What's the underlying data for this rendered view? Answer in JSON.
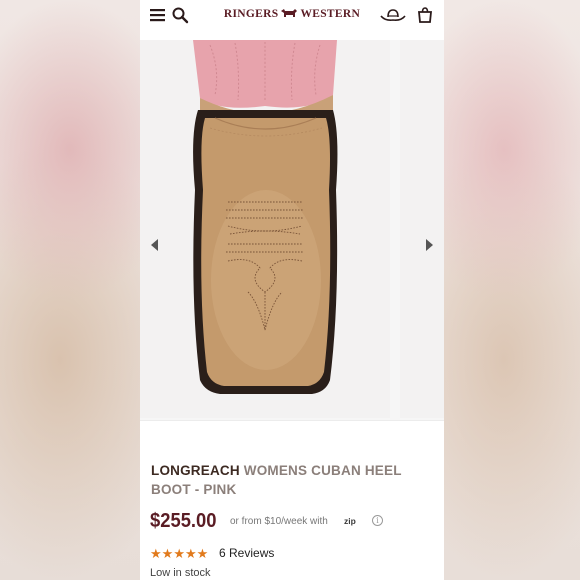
{
  "header": {
    "brand_left": "RINGERS",
    "brand_right": "WESTERN",
    "icons": [
      "menu-icon",
      "search-icon",
      "cowboy-hat-icon",
      "shopping-bag-icon"
    ]
  },
  "gallery": {
    "prev_icon": "chevron-left-icon",
    "next_icon": "chevron-right-icon"
  },
  "product": {
    "brand": "LONGREACH",
    "name_line1": "WOMENS CUBAN HEEL",
    "name_line2": "BOOT - PINK",
    "price": "$255.00",
    "installment": "or from $10/week with",
    "payment_provider": "zip",
    "rating": 5,
    "reviews": "6 Reviews",
    "stock": "Low in stock"
  },
  "colors": {
    "brand_maroon": "#5a1c24",
    "star_orange": "#e17a1c",
    "boot_tan": "#c49a6c",
    "shaft_pink": "#e7a3ac"
  }
}
